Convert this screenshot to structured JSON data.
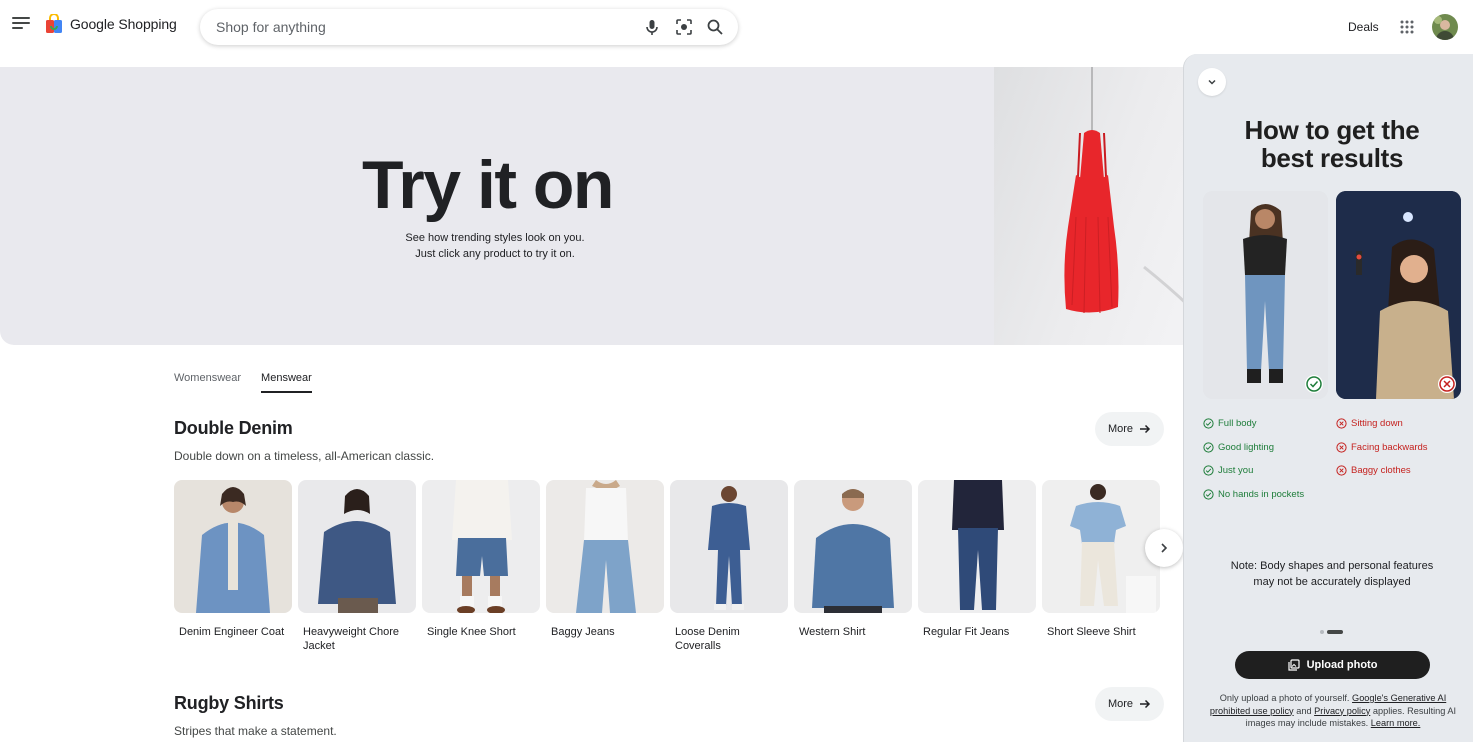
{
  "header": {
    "logo_text": "Google Shopping",
    "search_placeholder": "Shop for anything",
    "deals_label": "Deals"
  },
  "hero": {
    "title": "Try it on",
    "subtitle_line1": "See how trending styles look on you.",
    "subtitle_line2": "Just click any product to try it on."
  },
  "tabs": [
    {
      "label": "Womenswear",
      "active": false
    },
    {
      "label": "Menswear",
      "active": true
    }
  ],
  "sections": [
    {
      "title": "Double Denim",
      "subtitle": "Double down on a timeless, all-American classic.",
      "more_label": "More",
      "products": [
        {
          "name": "Denim Engineer Coat"
        },
        {
          "name": "Heavyweight Chore Jacket"
        },
        {
          "name": "Single Knee Short"
        },
        {
          "name": "Baggy Jeans"
        },
        {
          "name": "Loose Denim Coveralls"
        },
        {
          "name": "Western Shirt"
        },
        {
          "name": "Regular Fit Jeans"
        },
        {
          "name": "Short Sleeve Shirt"
        }
      ]
    },
    {
      "title": "Rugby Shirts",
      "subtitle": "Stripes that make a statement.",
      "more_label": "More"
    }
  ],
  "panel": {
    "title_line1": "How to get the",
    "title_line2": "best results",
    "good_tips": [
      "Full body",
      "Good lighting",
      "Just you",
      "No hands in pockets"
    ],
    "bad_tips": [
      "Sitting down",
      "Facing backwards",
      "Baggy clothes"
    ],
    "note_line1": "Note: Body shapes and personal features",
    "note_line2": "may not be accurately displayed",
    "upload_label": "Upload photo",
    "disclaimer": {
      "part1": "Only upload a photo of yourself.",
      "link1": "Google's Generative AI prohibited use policy",
      "part2": "and",
      "link2": "Privacy policy",
      "part3": "applies. Resulting AI images may include mistakes.",
      "link3": "Learn more."
    }
  },
  "colors": {
    "good": "#1e7d3a",
    "bad": "#c5221f",
    "hero_bg": "#e9e9ee",
    "panel_bg": "#e7eaee",
    "dress": "#e8262b"
  }
}
